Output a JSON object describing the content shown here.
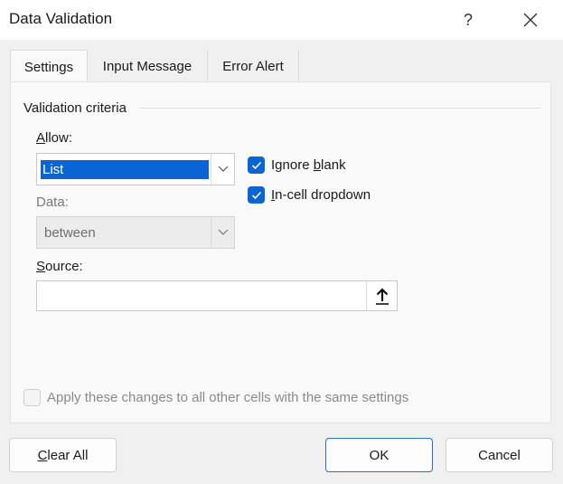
{
  "window": {
    "title": "Data Validation",
    "help_glyph": "?"
  },
  "tabs": [
    {
      "label": "Settings",
      "active": true
    },
    {
      "label": "Input Message",
      "active": false
    },
    {
      "label": "Error Alert",
      "active": false
    }
  ],
  "settings": {
    "group_label": "Validation criteria",
    "allow": {
      "label_mnemonic": "A",
      "label_rest": "llow:",
      "value": "List"
    },
    "data": {
      "label": "Data:",
      "value": "between"
    },
    "ignore_blank": {
      "label_before": "Ignore ",
      "label_mnemonic": "b",
      "label_after": "lank",
      "checked": true
    },
    "in_cell_dropdown": {
      "label_mnemonic": "I",
      "label_rest": "n-cell dropdown",
      "checked": true
    },
    "source": {
      "label_mnemonic": "S",
      "label_rest": "ource:",
      "value": ""
    },
    "apply_all": {
      "label": "Apply these changes to all other cells with the same settings",
      "checked": false
    }
  },
  "buttons": {
    "clear_all": {
      "mnemonic": "C",
      "rest": "lear All"
    },
    "ok": "OK",
    "cancel": "Cancel"
  },
  "colors": {
    "accent": "#0a64d4",
    "background": "#f0f0f0",
    "panel": "#f9f9f9"
  },
  "icons": {
    "close": "close-icon",
    "dropdown": "chevron-down-icon",
    "checkbox": "checkmark-icon",
    "source_picker": "collapse-dialog-arrow-up-icon"
  }
}
